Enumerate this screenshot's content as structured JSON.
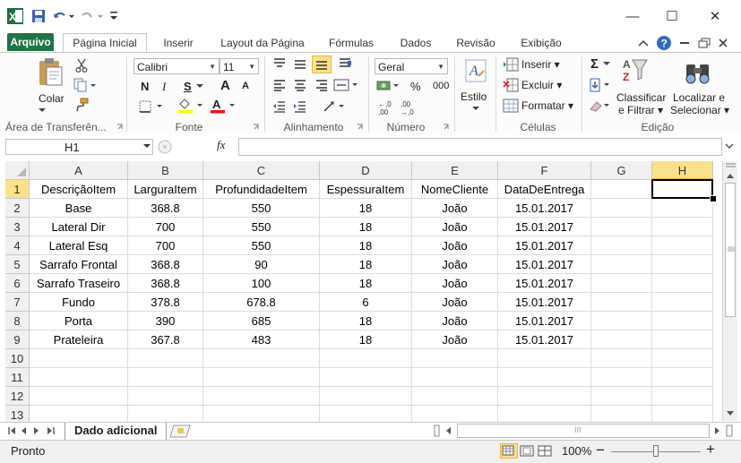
{
  "window": {
    "title_icon": "excel-logo",
    "minimize": "—",
    "maximize": "☐",
    "close": "✕"
  },
  "ribbon_tabs": [
    "Arquivo",
    "Página Inicial",
    "Inserir",
    "Layout da Página",
    "Fórmulas",
    "Dados",
    "Revisão",
    "Exibição"
  ],
  "clipboard": {
    "paste_label": "Colar",
    "group_label": "Área de Transferên..."
  },
  "font": {
    "name": "Calibri",
    "size": "11",
    "bold": "N",
    "italic": "I",
    "underline": "S",
    "grow": "A",
    "shrink": "A",
    "font_color": "A",
    "group_label": "Fonte"
  },
  "alignment": {
    "group_label": "Alinhamento"
  },
  "number": {
    "format": "Geral",
    "percent": "%",
    "thousands": "000",
    "inc_decimal": "⁺⁰ .00",
    "dec_decimal": ",00 →,0",
    "group_label": "Número"
  },
  "styles": {
    "label": "Estilo"
  },
  "cells": {
    "insert": "Inserir",
    "delete": "Excluir",
    "format": "Formatar",
    "group_label": "Células"
  },
  "editing": {
    "sum": "Σ",
    "sort_label_1": "Classificar",
    "sort_label_2": "e Filtrar",
    "find_label_1": "Localizar e",
    "find_label_2": "Selecionar",
    "group_label": "Edição"
  },
  "formula_bar": {
    "name_box": "H1",
    "fx": "fx",
    "value": ""
  },
  "grid": {
    "columns": [
      "A",
      "B",
      "C",
      "D",
      "E",
      "F",
      "G",
      "H"
    ],
    "rows": [
      "1",
      "2",
      "3",
      "4",
      "5",
      "6",
      "7",
      "8",
      "9",
      "10",
      "11",
      "12",
      "13"
    ],
    "header_row": [
      "DescriçãoItem",
      "LarguraItem",
      "ProfundidadeItem",
      "EspessuraItem",
      "NomeCliente",
      "DataDeEntrega",
      "",
      ""
    ],
    "data": [
      [
        "Base",
        "368.8",
        "550",
        "18",
        "João",
        "15.01.2017"
      ],
      [
        "Lateral Dir",
        "700",
        "550",
        "18",
        "João",
        "15.01.2017"
      ],
      [
        "Lateral Esq",
        "700",
        "550",
        "18",
        "João",
        "15.01.2017"
      ],
      [
        "Sarrafo Frontal",
        "368.8",
        "90",
        "18",
        "João",
        "15.01.2017"
      ],
      [
        "Sarrafo Traseiro",
        "368.8",
        "100",
        "18",
        "João",
        "15.01.2017"
      ],
      [
        "Fundo",
        "378.8",
        "678.8",
        "6",
        "João",
        "15.01.2017"
      ],
      [
        "Porta",
        "390",
        "685",
        "18",
        "João",
        "15.01.2017"
      ],
      [
        "Prateleira",
        "367.8",
        "483",
        "18",
        "João",
        "15.01.2017"
      ]
    ],
    "selected_cell": "H1"
  },
  "sheet_tabs": {
    "active": "Dado adicional",
    "scroll_label": "III"
  },
  "status": {
    "ready": "Pronto",
    "zoom": "100%",
    "zoom_out": "−",
    "zoom_in": "+"
  },
  "colors": {
    "file_tab": "#217346",
    "selection": "#217346",
    "header_bg": "#f0f0f0"
  }
}
